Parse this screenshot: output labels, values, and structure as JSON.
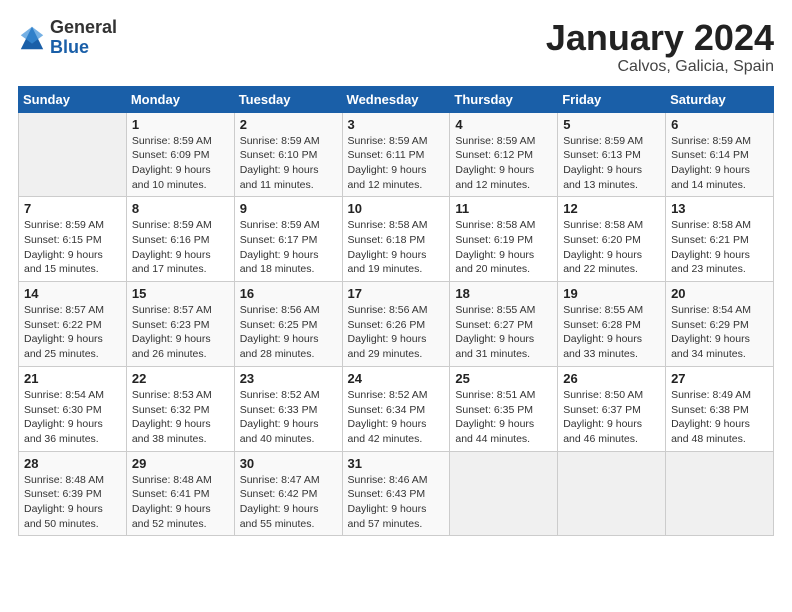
{
  "logo": {
    "general": "General",
    "blue": "Blue"
  },
  "title": "January 2024",
  "location": "Calvos, Galicia, Spain",
  "days_of_week": [
    "Sunday",
    "Monday",
    "Tuesday",
    "Wednesday",
    "Thursday",
    "Friday",
    "Saturday"
  ],
  "weeks": [
    [
      {
        "num": "",
        "empty": true
      },
      {
        "num": "1",
        "sunrise": "Sunrise: 8:59 AM",
        "sunset": "Sunset: 6:09 PM",
        "daylight": "Daylight: 9 hours and 10 minutes."
      },
      {
        "num": "2",
        "sunrise": "Sunrise: 8:59 AM",
        "sunset": "Sunset: 6:10 PM",
        "daylight": "Daylight: 9 hours and 11 minutes."
      },
      {
        "num": "3",
        "sunrise": "Sunrise: 8:59 AM",
        "sunset": "Sunset: 6:11 PM",
        "daylight": "Daylight: 9 hours and 12 minutes."
      },
      {
        "num": "4",
        "sunrise": "Sunrise: 8:59 AM",
        "sunset": "Sunset: 6:12 PM",
        "daylight": "Daylight: 9 hours and 12 minutes."
      },
      {
        "num": "5",
        "sunrise": "Sunrise: 8:59 AM",
        "sunset": "Sunset: 6:13 PM",
        "daylight": "Daylight: 9 hours and 13 minutes."
      },
      {
        "num": "6",
        "sunrise": "Sunrise: 8:59 AM",
        "sunset": "Sunset: 6:14 PM",
        "daylight": "Daylight: 9 hours and 14 minutes."
      }
    ],
    [
      {
        "num": "7",
        "sunrise": "Sunrise: 8:59 AM",
        "sunset": "Sunset: 6:15 PM",
        "daylight": "Daylight: 9 hours and 15 minutes."
      },
      {
        "num": "8",
        "sunrise": "Sunrise: 8:59 AM",
        "sunset": "Sunset: 6:16 PM",
        "daylight": "Daylight: 9 hours and 17 minutes."
      },
      {
        "num": "9",
        "sunrise": "Sunrise: 8:59 AM",
        "sunset": "Sunset: 6:17 PM",
        "daylight": "Daylight: 9 hours and 18 minutes."
      },
      {
        "num": "10",
        "sunrise": "Sunrise: 8:58 AM",
        "sunset": "Sunset: 6:18 PM",
        "daylight": "Daylight: 9 hours and 19 minutes."
      },
      {
        "num": "11",
        "sunrise": "Sunrise: 8:58 AM",
        "sunset": "Sunset: 6:19 PM",
        "daylight": "Daylight: 9 hours and 20 minutes."
      },
      {
        "num": "12",
        "sunrise": "Sunrise: 8:58 AM",
        "sunset": "Sunset: 6:20 PM",
        "daylight": "Daylight: 9 hours and 22 minutes."
      },
      {
        "num": "13",
        "sunrise": "Sunrise: 8:58 AM",
        "sunset": "Sunset: 6:21 PM",
        "daylight": "Daylight: 9 hours and 23 minutes."
      }
    ],
    [
      {
        "num": "14",
        "sunrise": "Sunrise: 8:57 AM",
        "sunset": "Sunset: 6:22 PM",
        "daylight": "Daylight: 9 hours and 25 minutes."
      },
      {
        "num": "15",
        "sunrise": "Sunrise: 8:57 AM",
        "sunset": "Sunset: 6:23 PM",
        "daylight": "Daylight: 9 hours and 26 minutes."
      },
      {
        "num": "16",
        "sunrise": "Sunrise: 8:56 AM",
        "sunset": "Sunset: 6:25 PM",
        "daylight": "Daylight: 9 hours and 28 minutes."
      },
      {
        "num": "17",
        "sunrise": "Sunrise: 8:56 AM",
        "sunset": "Sunset: 6:26 PM",
        "daylight": "Daylight: 9 hours and 29 minutes."
      },
      {
        "num": "18",
        "sunrise": "Sunrise: 8:55 AM",
        "sunset": "Sunset: 6:27 PM",
        "daylight": "Daylight: 9 hours and 31 minutes."
      },
      {
        "num": "19",
        "sunrise": "Sunrise: 8:55 AM",
        "sunset": "Sunset: 6:28 PM",
        "daylight": "Daylight: 9 hours and 33 minutes."
      },
      {
        "num": "20",
        "sunrise": "Sunrise: 8:54 AM",
        "sunset": "Sunset: 6:29 PM",
        "daylight": "Daylight: 9 hours and 34 minutes."
      }
    ],
    [
      {
        "num": "21",
        "sunrise": "Sunrise: 8:54 AM",
        "sunset": "Sunset: 6:30 PM",
        "daylight": "Daylight: 9 hours and 36 minutes."
      },
      {
        "num": "22",
        "sunrise": "Sunrise: 8:53 AM",
        "sunset": "Sunset: 6:32 PM",
        "daylight": "Daylight: 9 hours and 38 minutes."
      },
      {
        "num": "23",
        "sunrise": "Sunrise: 8:52 AM",
        "sunset": "Sunset: 6:33 PM",
        "daylight": "Daylight: 9 hours and 40 minutes."
      },
      {
        "num": "24",
        "sunrise": "Sunrise: 8:52 AM",
        "sunset": "Sunset: 6:34 PM",
        "daylight": "Daylight: 9 hours and 42 minutes."
      },
      {
        "num": "25",
        "sunrise": "Sunrise: 8:51 AM",
        "sunset": "Sunset: 6:35 PM",
        "daylight": "Daylight: 9 hours and 44 minutes."
      },
      {
        "num": "26",
        "sunrise": "Sunrise: 8:50 AM",
        "sunset": "Sunset: 6:37 PM",
        "daylight": "Daylight: 9 hours and 46 minutes."
      },
      {
        "num": "27",
        "sunrise": "Sunrise: 8:49 AM",
        "sunset": "Sunset: 6:38 PM",
        "daylight": "Daylight: 9 hours and 48 minutes."
      }
    ],
    [
      {
        "num": "28",
        "sunrise": "Sunrise: 8:48 AM",
        "sunset": "Sunset: 6:39 PM",
        "daylight": "Daylight: 9 hours and 50 minutes."
      },
      {
        "num": "29",
        "sunrise": "Sunrise: 8:48 AM",
        "sunset": "Sunset: 6:41 PM",
        "daylight": "Daylight: 9 hours and 52 minutes."
      },
      {
        "num": "30",
        "sunrise": "Sunrise: 8:47 AM",
        "sunset": "Sunset: 6:42 PM",
        "daylight": "Daylight: 9 hours and 55 minutes."
      },
      {
        "num": "31",
        "sunrise": "Sunrise: 8:46 AM",
        "sunset": "Sunset: 6:43 PM",
        "daylight": "Daylight: 9 hours and 57 minutes."
      },
      {
        "num": "",
        "empty": true
      },
      {
        "num": "",
        "empty": true
      },
      {
        "num": "",
        "empty": true
      }
    ]
  ]
}
